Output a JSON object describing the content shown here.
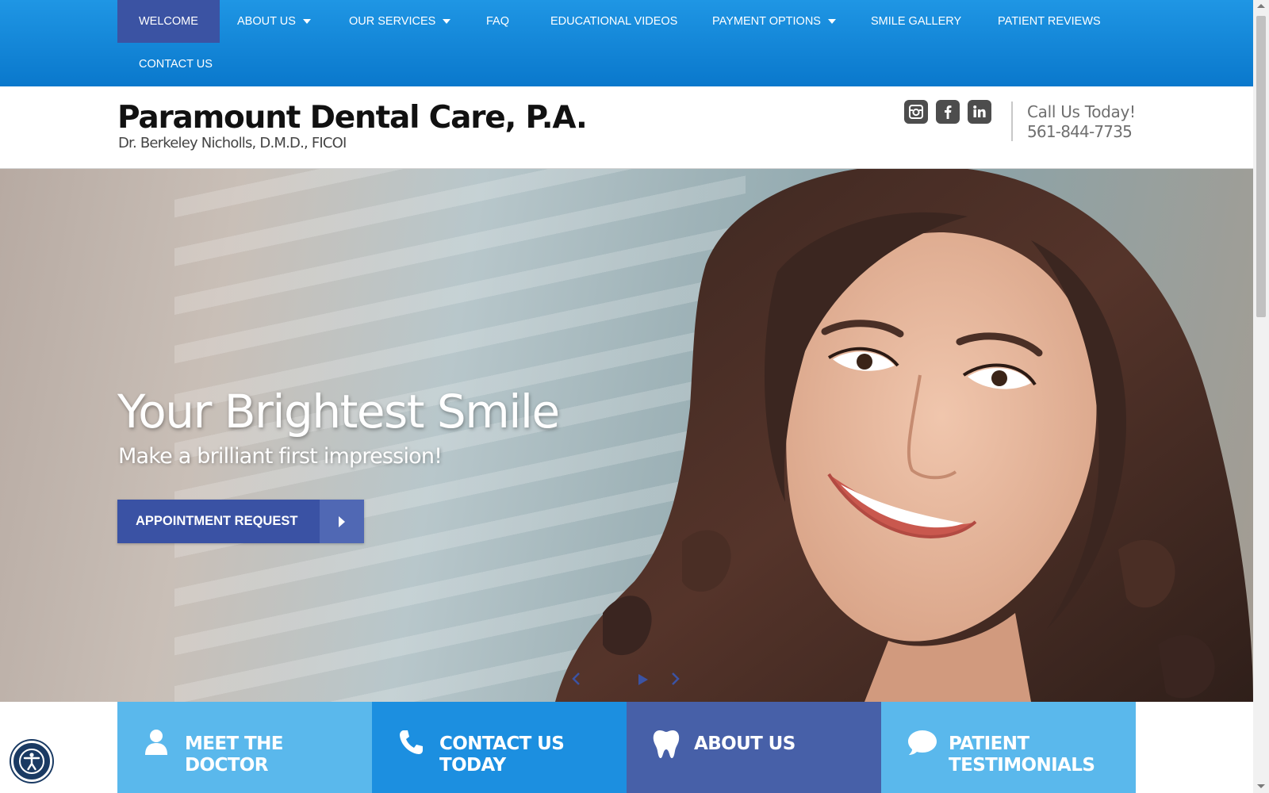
{
  "nav": {
    "items": [
      {
        "label": "WELCOME",
        "active": true
      },
      {
        "label": "ABOUT US",
        "has_dropdown": true
      },
      {
        "label": "OUR SERVICES",
        "has_dropdown": true
      },
      {
        "label": "FAQ"
      },
      {
        "label": "EDUCATIONAL VIDEOS"
      },
      {
        "label": "PAYMENT OPTIONS",
        "has_dropdown": true
      },
      {
        "label": "SMILE GALLERY"
      },
      {
        "label": "PATIENT REVIEWS"
      },
      {
        "label": "CONTACT US"
      }
    ]
  },
  "header": {
    "title": "Paramount Dental Care, P.A.",
    "subtitle": "Dr. Berkeley Nicholls, D.M.D., FICOI",
    "social": [
      {
        "icon": "instagram-icon"
      },
      {
        "icon": "facebook-icon"
      },
      {
        "icon": "linkedin-icon"
      }
    ],
    "call_label": "Call Us Today!",
    "phone": "561-844-7735"
  },
  "hero": {
    "headline": "Your Brightest Smile",
    "subheadline": "Make a brilliant first impression!",
    "cta_label": "APPOINTMENT REQUEST"
  },
  "tiles": [
    {
      "label": "MEET THE DOCTOR",
      "icon": "person-icon",
      "color": "#5ab8ec"
    },
    {
      "label": "CONTACT US TODAY",
      "icon": "phone-icon",
      "color": "#1c8fe0"
    },
    {
      "label": "ABOUT US",
      "icon": "tooth-icon",
      "color": "#4760a8"
    },
    {
      "label": "PATIENT TESTIMONIALS",
      "icon": "speech-bubble-icon",
      "color": "#5ab8ec"
    }
  ],
  "colors": {
    "nav_bg": "#1a8ade",
    "nav_active": "#3b53a3",
    "cta": "#3a52a4",
    "header_text": "#111111"
  }
}
